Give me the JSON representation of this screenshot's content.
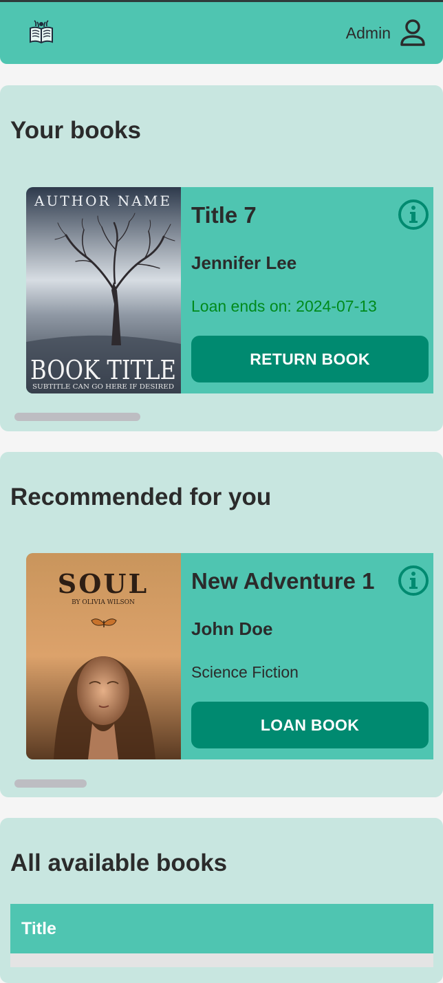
{
  "header": {
    "user_name": "Admin"
  },
  "your_books": {
    "title": "Your books",
    "book": {
      "cover_top": "AUTHOR NAME",
      "cover_title": "BOOK TITLE",
      "cover_subtitle": "SUBTITLE CAN GO HERE IF DESIRED",
      "title": "Title 7",
      "author": "Jennifer Lee",
      "loan_info": "Loan ends on: 2024-07-13",
      "button": "RETURN BOOK"
    }
  },
  "recommended": {
    "title": "Recommended for you",
    "book": {
      "cover_title": "SOUL",
      "cover_author": "BY OLIVIA WILSON",
      "title": "New Adventure 1",
      "author": "John Doe",
      "genre": "Science Fiction",
      "button": "LOAN BOOK"
    }
  },
  "all_books": {
    "title": "All available books",
    "columns": [
      "Title"
    ]
  },
  "colors": {
    "accent": "#4fc5b1",
    "section_bg": "#c8e6e0",
    "button": "#008a70",
    "loan_text": "#008a1c"
  }
}
